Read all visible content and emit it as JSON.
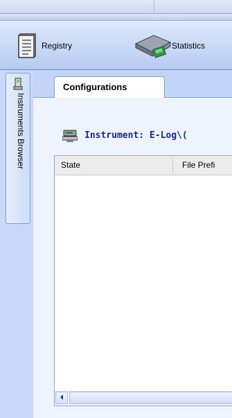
{
  "toolbar": {
    "registry_label": "Registry",
    "statistics_label": "Statistics"
  },
  "sidebar": {
    "instruments_browser_label": "Instruments Browser"
  },
  "tabs": [
    {
      "label": "Configurations",
      "active": true
    }
  ],
  "instrument": {
    "label": "Instrument: E-Log\\("
  },
  "grid": {
    "columns": [
      "State",
      "File Prefi"
    ]
  },
  "icons": {
    "registry": "registry-book-icon",
    "statistics": "statistics-scanner-icon",
    "instruments": "instrument-terminal-icon",
    "scroll_left": "chevron-left-icon"
  },
  "colors": {
    "toolbar_bg": "#c8d8f6",
    "panel_bg": "#c2d4f7",
    "content_bg": "#eef3fd",
    "instrument_text": "#1a2a8c"
  }
}
